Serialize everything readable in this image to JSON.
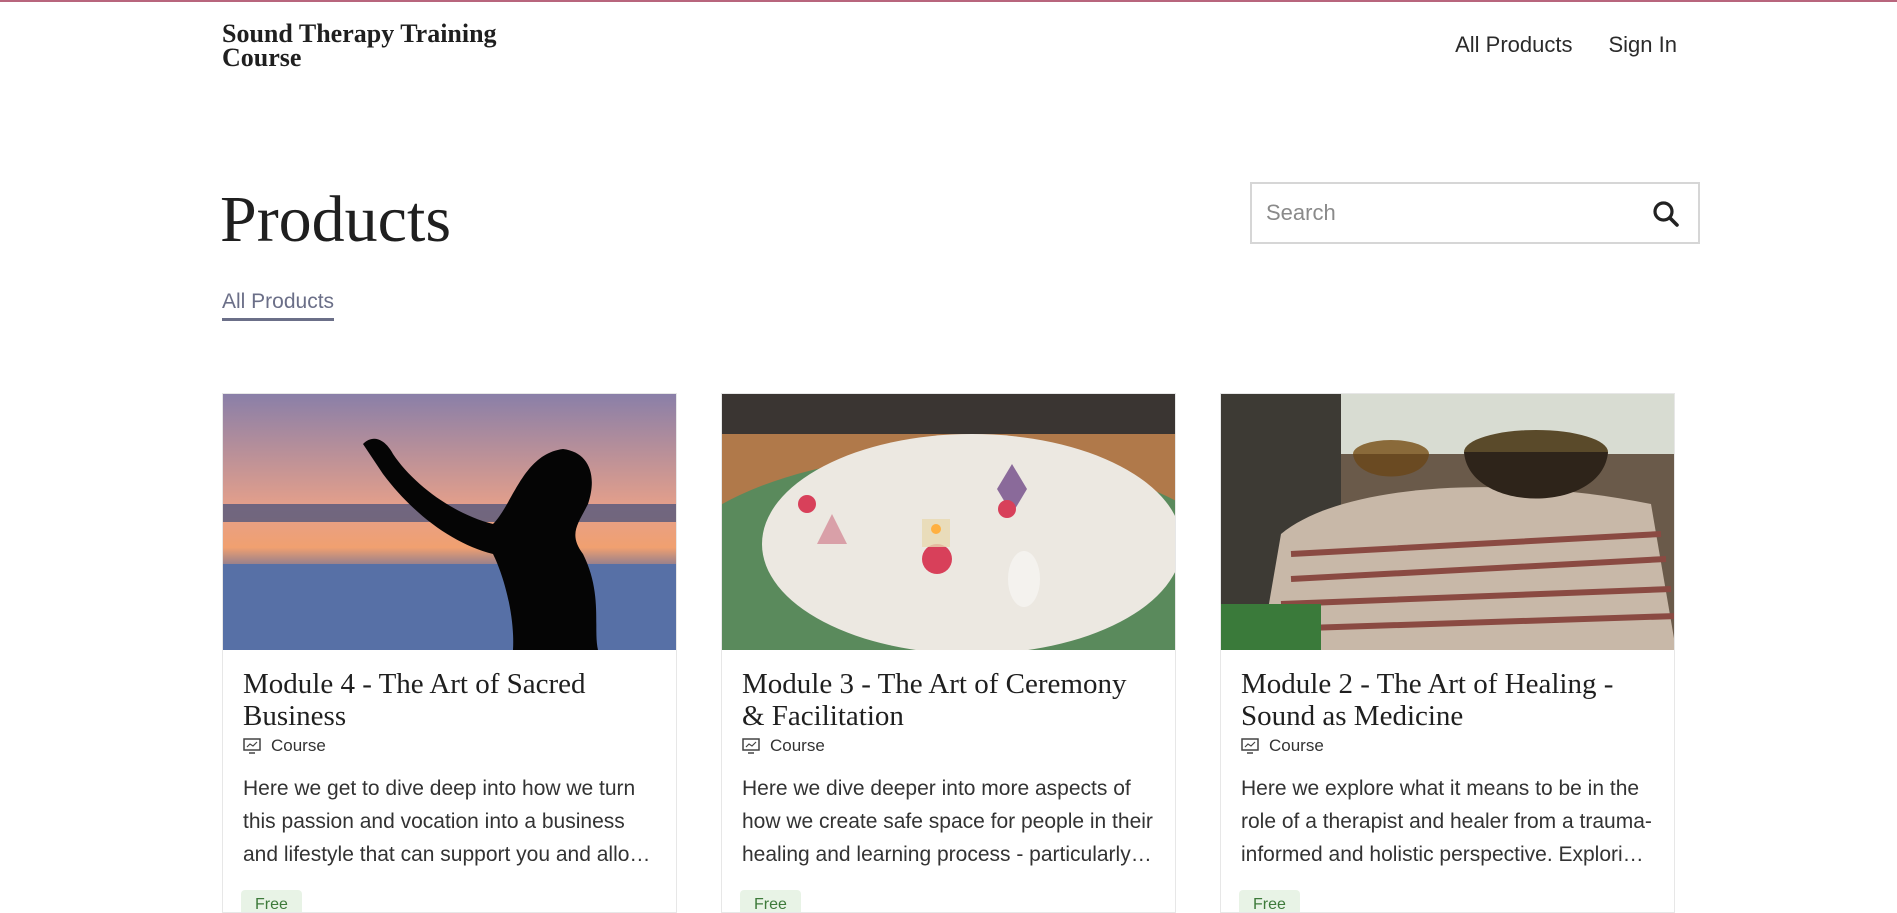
{
  "header": {
    "brand": "Sound Therapy Training Course",
    "nav": {
      "all_products": "All Products",
      "sign_in": "Sign In"
    }
  },
  "main": {
    "title": "Products",
    "search": {
      "placeholder": "Search"
    },
    "filter_tab": "All Products"
  },
  "products": [
    {
      "title": "Module 4 - The Art of Sacred Business",
      "type": "Course",
      "description": "Here we get to dive deep into how we turn this passion and vocation into a business and lifestyle that can support you and allo…",
      "price": "Free",
      "image": "silhouette-at-sunset"
    },
    {
      "title": "Module 3 - The Art of Ceremony & Facilitation",
      "type": "Course",
      "description": "Here we dive deeper into more aspects of how we create safe space for people in their healing and learning process - particularly…",
      "price": "Free",
      "image": "crystal-ceremony-table"
    },
    {
      "title": "Module 2 - The Art of Healing - Sound as Medicine",
      "type": "Course",
      "description": "Here we explore what it means to be in the role of a therapist and healer from a trauma-informed and holistic perspective. Explori…",
      "price": "Free",
      "image": "singing-bowls-on-blanket"
    }
  ],
  "colors": {
    "accent": "#b8657d",
    "tab": "#6b6f88",
    "badge_bg": "#e8f3e6",
    "badge_text": "#3d7a3a"
  }
}
